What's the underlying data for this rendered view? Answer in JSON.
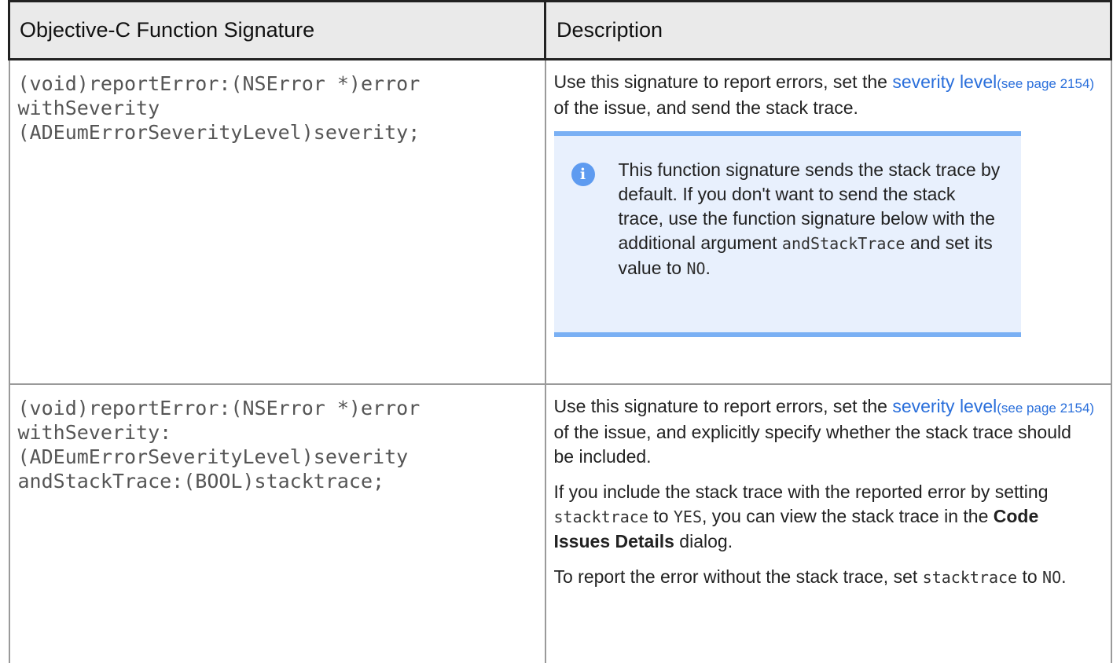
{
  "header": {
    "col1": "Objective-C Function Signature",
    "col2": "Description"
  },
  "row1": {
    "signature": "(void)reportError:(NSError *)error\nwithSeverity\n(ADEumErrorSeverityLevel)severity;",
    "desc_before": "Use this signature to report errors, set the ",
    "link_text": "severity level",
    "link_ref": "(see page 2154)",
    "desc_after": " of the issue, and send the stack trace.",
    "note": {
      "text_before": "This function signature sends the stack trace by default. If you don't want to send the stack trace, use the function signature below with the additional argument ",
      "code1": "andStackTrace",
      "text_middle": " and set its value to ",
      "code2": "NO",
      "text_after": "."
    }
  },
  "row2": {
    "signature": "(void)reportError:(NSError *)error\nwithSeverity:\n(ADEumErrorSeverityLevel)severity\nandStackTrace:(BOOL)stacktrace;",
    "p1_before": "Use this signature to report errors, set the ",
    "link_text": "severity level",
    "link_ref": "(see page 2154)",
    "p1_after": " of the issue, and explicitly specify whether the stack trace should be included.",
    "p2_a": "If you include the stack trace with the reported error by setting ",
    "p2_code1": "stacktrace",
    "p2_b": " to ",
    "p2_code2": "YES",
    "p2_c": ", you can view the stack trace in the ",
    "p2_bold": "Code Issues Details",
    "p2_d": " dialog.",
    "p3_a": "To report the error without the stack trace, set ",
    "p3_code1": "stacktrace",
    "p3_b": " to ",
    "p3_code2": "NO",
    "p3_c": "."
  }
}
